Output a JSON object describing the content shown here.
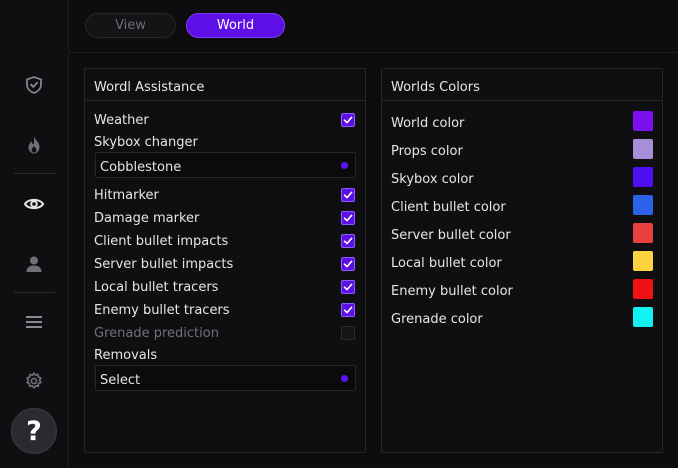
{
  "tabs": {
    "view": "View",
    "world": "World"
  },
  "help": {
    "label": "?"
  },
  "assistance": {
    "title": "Wordl Assistance",
    "weather": {
      "label": "Weather",
      "checked": true
    },
    "skybox": {
      "label": "Skybox changer",
      "value": "Cobblestone"
    },
    "hitmarker": {
      "label": "Hitmarker",
      "checked": true
    },
    "damage_marker": {
      "label": "Damage marker",
      "checked": true
    },
    "client_impacts": {
      "label": "Client bullet impacts",
      "checked": true
    },
    "server_impacts": {
      "label": "Server bullet impacts",
      "checked": true
    },
    "local_tracers": {
      "label": "Local bullet tracers",
      "checked": true
    },
    "enemy_tracers": {
      "label": "Enemy bullet tracers",
      "checked": true
    },
    "grenade_prediction": {
      "label": "Grenade prediction",
      "checked": false
    },
    "removals": {
      "label": "Removals",
      "value": "Select"
    }
  },
  "colors": {
    "title": "Worlds Colors",
    "items": [
      {
        "label": "World color",
        "color": "#7a0ff0"
      },
      {
        "label": "Props color",
        "color": "#a68fd6"
      },
      {
        "label": "Skybox color",
        "color": "#4f0ff2"
      },
      {
        "label": "Client bullet color",
        "color": "#2a63e8"
      },
      {
        "label": "Server bullet color",
        "color": "#e84040"
      },
      {
        "label": "Local bullet color",
        "color": "#fcd440"
      },
      {
        "label": "Enemy bullet color",
        "color": "#f01212"
      },
      {
        "label": "Grenade color",
        "color": "#12f2f2"
      }
    ]
  },
  "accent_color": "#5d10e6",
  "sidebar_icons": [
    "shield-icon",
    "flame-icon",
    "eye-icon",
    "user-icon",
    "menu-icon",
    "gear-icon",
    "help-icon"
  ]
}
